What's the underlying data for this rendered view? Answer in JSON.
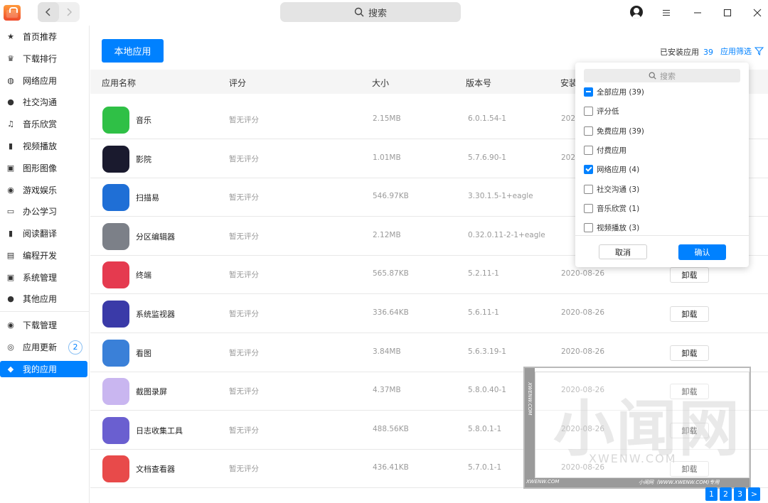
{
  "titlebar": {
    "search_placeholder": "搜索",
    "back_icon": "chevron-left-icon",
    "forward_icon": "chevron-right-icon"
  },
  "sidebar": {
    "items": [
      {
        "label": "首页推荐",
        "icon": "star-icon",
        "glyph": "★"
      },
      {
        "label": "下载排行",
        "icon": "crown-icon",
        "glyph": "♛"
      },
      {
        "label": "网络应用",
        "icon": "globe-icon",
        "glyph": "◍"
      },
      {
        "label": "社交沟通",
        "icon": "chat-icon",
        "glyph": "●"
      },
      {
        "label": "音乐欣赏",
        "icon": "music-icon",
        "glyph": "♫"
      },
      {
        "label": "视频播放",
        "icon": "film-icon",
        "glyph": "▮"
      },
      {
        "label": "图形图像",
        "icon": "image-icon",
        "glyph": "▣"
      },
      {
        "label": "游戏娱乐",
        "icon": "gamepad-icon",
        "glyph": "◉"
      },
      {
        "label": "办公学习",
        "icon": "monitor-icon",
        "glyph": "▭"
      },
      {
        "label": "阅读翻译",
        "icon": "book-icon",
        "glyph": "▮"
      },
      {
        "label": "编程开发",
        "icon": "code-icon",
        "glyph": "▤"
      },
      {
        "label": "系统管理",
        "icon": "settings-icon",
        "glyph": "▣"
      },
      {
        "label": "其他应用",
        "icon": "more-icon",
        "glyph": "●"
      }
    ],
    "bottom_items": [
      {
        "label": "下载管理",
        "icon": "download-icon",
        "glyph": "◉"
      },
      {
        "label": "应用更新",
        "icon": "refresh-icon",
        "glyph": "◎",
        "badge": "2"
      },
      {
        "label": "我的应用",
        "icon": "package-icon",
        "glyph": "◆"
      }
    ]
  },
  "main": {
    "local_button": "本地应用",
    "installed_label": "已安装应用",
    "installed_count": "39",
    "filter_label": "应用筛选",
    "columns": [
      "应用名称",
      "评分",
      "大小",
      "版本号",
      "安装"
    ],
    "rows": [
      {
        "name": "音乐",
        "rating": "暂无评分",
        "size": "2.15MB",
        "version": "6.0.1.54-1",
        "date": "2020",
        "action": "",
        "color": "#2fc046"
      },
      {
        "name": "影院",
        "rating": "暂无评分",
        "size": "1.01MB",
        "version": "5.7.6.90-1",
        "date": "2020",
        "action": "",
        "color": "#1a1a2e"
      },
      {
        "name": "扫描易",
        "rating": "暂无评分",
        "size": "546.97KB",
        "version": "3.30.1.5-1+eagle",
        "date": "",
        "action": "",
        "color": "#1f6fd6"
      },
      {
        "name": "分区编辑器",
        "rating": "暂无评分",
        "size": "2.12MB",
        "version": "0.32.0.11-2-1+eagle",
        "date": "",
        "action": "",
        "color": "#7c8088"
      },
      {
        "name": "终端",
        "rating": "暂无评分",
        "size": "565.87KB",
        "version": "5.2.11-1",
        "date": "2020-08-26",
        "action": "卸载",
        "color": "#e53a4f"
      },
      {
        "name": "系统监视器",
        "rating": "暂无评分",
        "size": "336.64KB",
        "version": "5.6.11-1",
        "date": "2020-08-26",
        "action": "卸载",
        "color": "#3a3aa8"
      },
      {
        "name": "看图",
        "rating": "暂无评分",
        "size": "3.84MB",
        "version": "5.6.3.19-1",
        "date": "2020-08-26",
        "action": "卸载",
        "color": "#3a80d8"
      },
      {
        "name": "截图录屏",
        "rating": "暂无评分",
        "size": "4.37MB",
        "version": "5.8.0.40-1",
        "date": "2020-08-26",
        "action": "卸载",
        "color": "#c9b6f0"
      },
      {
        "name": "日志收集工具",
        "rating": "暂无评分",
        "size": "488.56KB",
        "version": "5.8.0.1-1",
        "date": "2020-08-26",
        "action": "卸载",
        "color": "#6a5fd0"
      },
      {
        "name": "文档查看器",
        "rating": "暂无评分",
        "size": "436.41KB",
        "version": "5.7.0.1-1",
        "date": "2020-08-26",
        "action": "卸载",
        "color": "#e84a4a"
      }
    ]
  },
  "filter_dropdown": {
    "search_placeholder": "搜索",
    "options": [
      {
        "label": "全部应用 (39)",
        "state": "partial"
      },
      {
        "label": "评分低",
        "state": "unchecked"
      },
      {
        "label": "免费应用 (39)",
        "state": "unchecked"
      },
      {
        "label": "付费应用",
        "state": "unchecked"
      },
      {
        "label": "网络应用 (4)",
        "state": "checked"
      },
      {
        "label": "社交沟通 (3)",
        "state": "unchecked"
      },
      {
        "label": "音乐欣赏 (1)",
        "state": "unchecked"
      },
      {
        "label": "视频播放 (3)",
        "state": "unchecked"
      }
    ],
    "cancel": "取消",
    "confirm": "确认"
  },
  "pagination": {
    "pages": [
      "1",
      "2",
      "3"
    ],
    "next": ">"
  },
  "watermark": {
    "big": "小闻网",
    "url": "XWENW.COM",
    "side": "XWENW.COM",
    "bar_left": "XWENW.COM",
    "bar_right": "小闻网（WWW.XWENW.COM)专用"
  },
  "colors": {
    "accent": "#0081ff"
  }
}
